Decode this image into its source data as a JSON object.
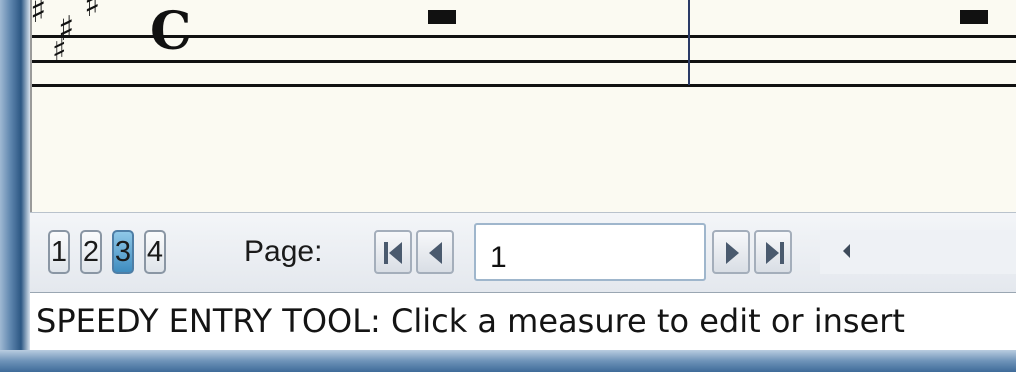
{
  "score": {
    "key_signature": "sharps",
    "time_signature": "C"
  },
  "page_tabs": [
    "1",
    "2",
    "3",
    "4"
  ],
  "active_page_tab": "3",
  "navigator": {
    "page_label": "Page:",
    "page_value": "1"
  },
  "status_bar": {
    "text": "SPEEDY ENTRY TOOL: Click a measure to edit or insert"
  },
  "icons": {
    "first": "first-page-icon",
    "prev": "previous-page-icon",
    "next": "next-page-icon",
    "last": "last-page-icon",
    "scroll_left": "scroll-left-arrow-icon"
  },
  "colors": {
    "active_tab": "#3e8cbf",
    "paper": "#fbfaf2",
    "frame": "#2f5a86"
  }
}
